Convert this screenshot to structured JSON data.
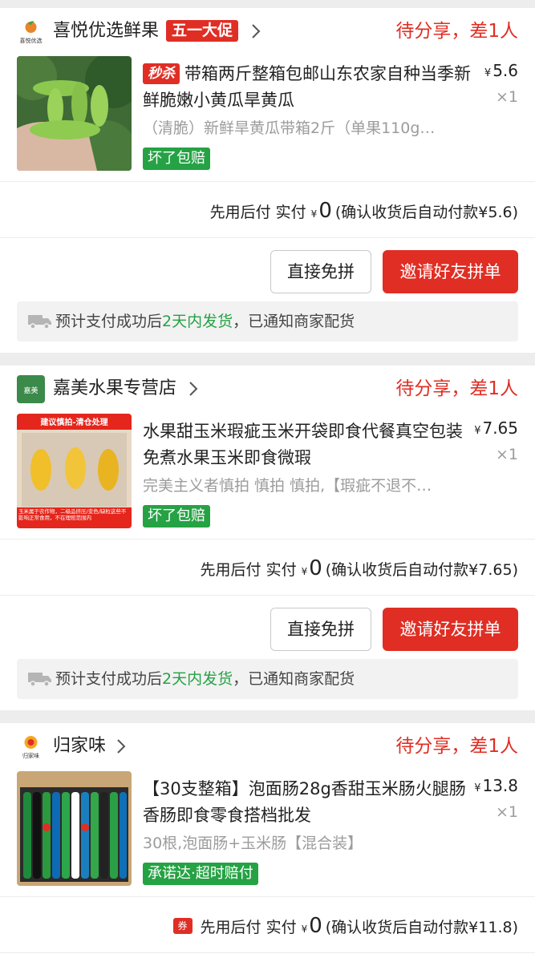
{
  "orders": [
    {
      "shop": {
        "name": "喜悦优选鲜果",
        "logo_text": "喜悦优选",
        "promo": "五一大促"
      },
      "status": "待分享，差1人",
      "product": {
        "badge": "秒杀",
        "title": "带箱两斤整箱包邮山东农家自种当季新鲜脆嫩小黄瓜旱黄瓜",
        "spec": "（清脆）新鲜旱黄瓜带箱2斤（单果110g…",
        "tag": "坏了包赔",
        "price_symbol": "¥",
        "price": "5.6",
        "qty": "×1"
      },
      "payment": {
        "prefix": "先用后付",
        "paid_label": "实付",
        "symbol": "¥",
        "amount": "0",
        "note": "(确认收货后自动付款¥5.6)"
      },
      "buttons": {
        "direct": "直接免拼",
        "invite": "邀请好友拼单"
      },
      "shipping": {
        "before": "预计支付成功后",
        "highlight": "2天内发货",
        "after": "，已通知商家配货"
      }
    },
    {
      "shop": {
        "name": "嘉美水果专营店",
        "logo_text": "嘉美"
      },
      "status": "待分享，差1人",
      "product": {
        "title": "水果甜玉米瑕疵玉米开袋即食代餐真空包装免煮水果玉米即食微瑕",
        "spec": "完美主义者慎拍 慎拍 慎拍,【瑕疵不退不…",
        "tag": "坏了包赔",
        "thumb_top": "建议慎拍-清仓处理",
        "thumb_bottom": "玉米属于农作物，二级品挤压/变色/缺粒这些不影响正常食用，不在理赔范围内",
        "price_symbol": "¥",
        "price": "7.65",
        "qty": "×1"
      },
      "payment": {
        "prefix": "先用后付",
        "paid_label": "实付",
        "symbol": "¥",
        "amount": "0",
        "note": "(确认收货后自动付款¥7.65)"
      },
      "buttons": {
        "direct": "直接免拼",
        "invite": "邀请好友拼单"
      },
      "shipping": {
        "before": "预计支付成功后",
        "highlight": "2天内发货",
        "after": "，已通知商家配货"
      }
    },
    {
      "shop": {
        "name": "归家味",
        "logo_text": "归家味"
      },
      "status": "待分享，差1人",
      "product": {
        "title": "【30支整箱】泡面肠28g香甜玉米肠火腿肠香肠即食零食搭档批发",
        "spec": "30根,泡面肠+玉米肠【混合装】",
        "tag": "承诺达·超时赔付",
        "price_symbol": "¥",
        "price": "13.8",
        "qty": "×1"
      },
      "payment": {
        "coupon": "券",
        "prefix": "先用后付",
        "paid_label": "实付",
        "symbol": "¥",
        "amount": "0",
        "note": "(确认收货后自动付款¥11.8)"
      }
    }
  ],
  "colors": {
    "accent": "#e02e24",
    "green": "#25a244",
    "muted": "#9c9c9c",
    "background": "#ededed"
  },
  "icons": [
    "shop-logo-icon",
    "chevron-right-icon",
    "truck-icon"
  ]
}
